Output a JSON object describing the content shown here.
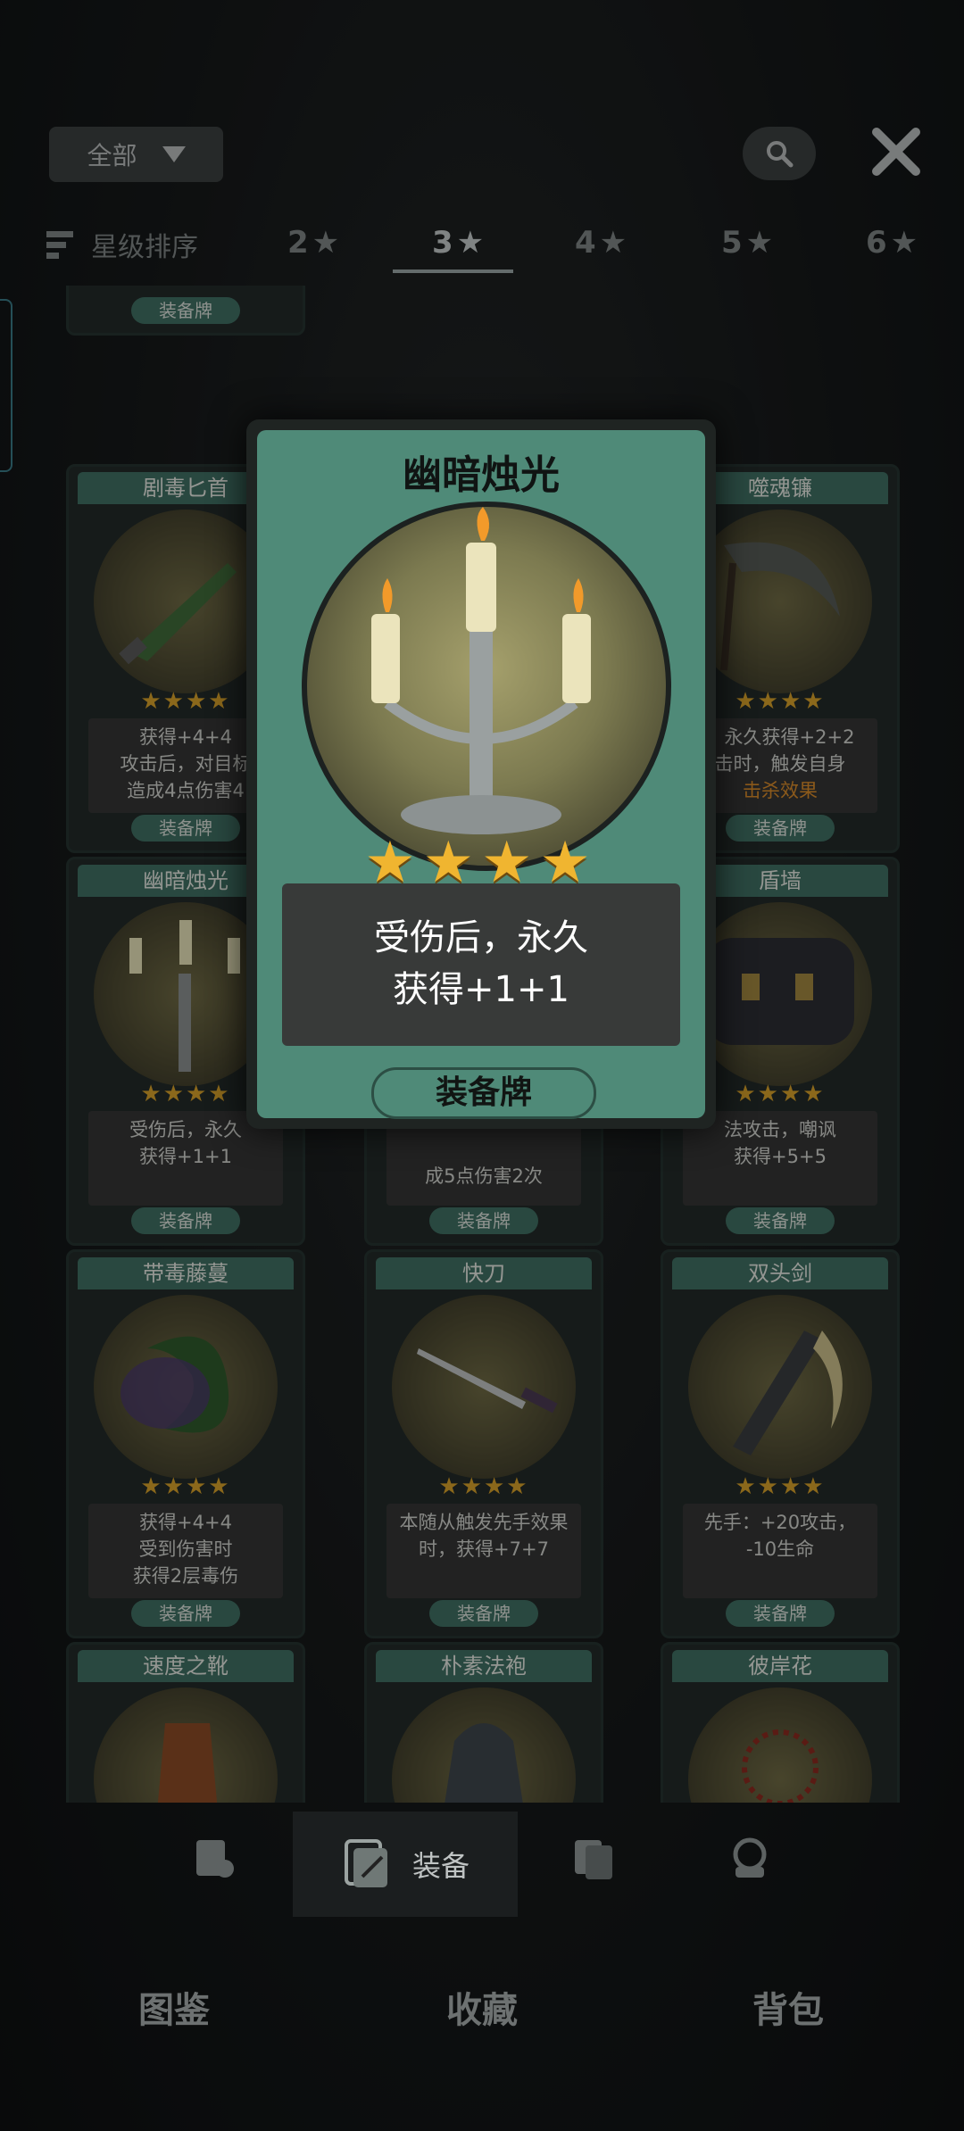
{
  "header": {
    "filter_label": "全部",
    "filter_icon": "chevron-down-icon",
    "search_icon": "search-icon",
    "close_icon": "close-icon"
  },
  "sort": {
    "label": "星级排序",
    "tabs": [
      {
        "label": "2",
        "star": "★"
      },
      {
        "label": "3",
        "star": "★"
      },
      {
        "label": "4",
        "star": "★"
      },
      {
        "label": "5",
        "star": "★"
      },
      {
        "label": "6",
        "star": "★"
      }
    ],
    "active_index": 1
  },
  "partial_top": {
    "tag": "装备牌"
  },
  "cards": [
    {
      "name": "剧毒匕首",
      "stars": "★★★★",
      "desc": [
        "获得+4+4",
        "攻击后，对目标",
        "造成4点伤害4"
      ],
      "tag": "装备牌"
    },
    {
      "name": "噬魂镰",
      "stars": "★★★★",
      "desc": [
        "：永久获得+2+2",
        "击时，触发自身",
        "击杀效果"
      ],
      "tag": "装备牌"
    },
    {
      "name": "幽暗烛光",
      "stars": "★★★★",
      "desc": [
        "受伤后，永久",
        "获得+1+1"
      ],
      "tag": "装备牌"
    },
    {
      "name": "",
      "stars": "",
      "desc": [
        "成5点伤害2次"
      ],
      "tag": "装备牌"
    },
    {
      "name": "盾墙",
      "stars": "★★★★",
      "desc": [
        "法攻击，嘲讽",
        "获得+5+5"
      ],
      "tag": "装备牌"
    },
    {
      "name": "带毒藤蔓",
      "stars": "★★★★",
      "desc": [
        "获得+4+4",
        "受到伤害时",
        "获得2层毒伤"
      ],
      "tag": "装备牌"
    },
    {
      "name": "快刀",
      "stars": "★★★★",
      "desc": [
        "本随从触发先手效果",
        "时，获得+7+7"
      ],
      "tag": "装备牌"
    },
    {
      "name": "双头剑",
      "stars": "★★★★",
      "desc": [
        "先手：+20攻击，",
        "-10生命"
      ],
      "tag": "装备牌"
    },
    {
      "name": "速度之靴",
      "stars": "",
      "desc": [],
      "tag": ""
    },
    {
      "name": "朴素法袍",
      "stars": "",
      "desc": [],
      "tag": ""
    },
    {
      "name": "彼岸花",
      "stars": "",
      "desc": [],
      "tag": ""
    }
  ],
  "popup": {
    "title": "幽暗烛光",
    "stars": "★★★★",
    "desc_line1": "受伤后，永久",
    "desc_line2": "获得+1+1",
    "tag": "装备牌",
    "art_icon": "candelabra-icon"
  },
  "subnav": {
    "active_label": "装备"
  },
  "bottom_tabs": [
    "图鉴",
    "收藏",
    "背包"
  ],
  "colors": {
    "accent_teal": "#4f8a78",
    "star_gold": "#f0b530",
    "highlight": "#d6a02a"
  }
}
